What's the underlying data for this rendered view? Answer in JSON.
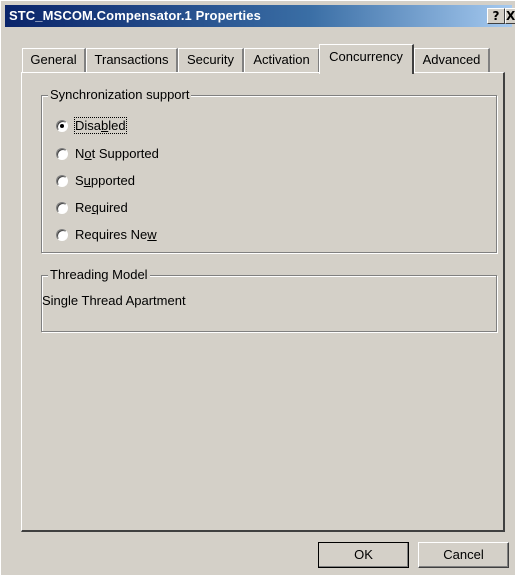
{
  "window": {
    "title": "STC_MSCOM.Compensator.1 Properties"
  },
  "titlebar_buttons": {
    "help": "?",
    "close": "X"
  },
  "tabs": [
    {
      "label": "General"
    },
    {
      "label": "Transactions"
    },
    {
      "label": "Security"
    },
    {
      "label": "Activation"
    },
    {
      "label": "Concurrency",
      "active": true
    },
    {
      "label": "Advanced"
    }
  ],
  "sync": {
    "legend": "Synchronization support",
    "options": [
      {
        "pre": "Disa",
        "key": "b",
        "post": "led",
        "selected": true
      },
      {
        "pre": "N",
        "key": "o",
        "post": "t Supported",
        "selected": false
      },
      {
        "pre": "S",
        "key": "u",
        "post": "pported",
        "selected": false
      },
      {
        "pre": "Re",
        "key": "q",
        "post": "uired",
        "selected": false
      },
      {
        "pre": "Requires Ne",
        "key": "w",
        "post": "",
        "selected": false
      }
    ]
  },
  "threading": {
    "legend": "Threading Model",
    "value": "Single Thread Apartment"
  },
  "buttons": {
    "ok": "OK",
    "cancel": "Cancel"
  }
}
